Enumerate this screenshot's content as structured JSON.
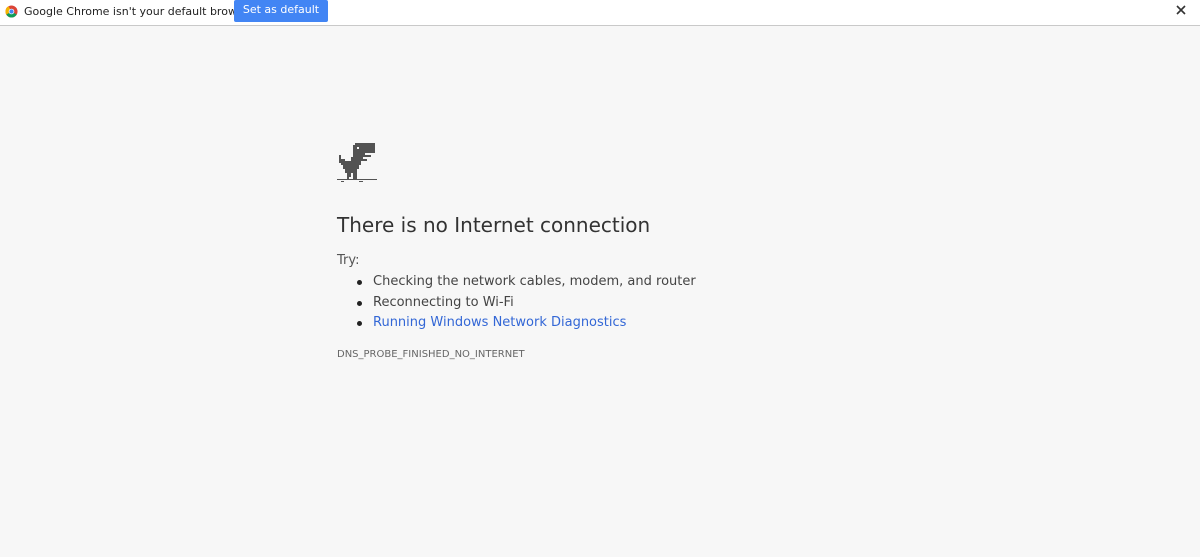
{
  "infobar": {
    "message": "Google Chrome isn't your default browser.",
    "button_label": "Set as default",
    "logo_icon": "chrome-logo-icon",
    "close_icon": "close-icon",
    "button_color": "#4285f4"
  },
  "main": {
    "dino_icon": "dino-icon",
    "title": "There is no Internet connection",
    "try_label": "Try:",
    "suggestions": [
      "Checking the network cables, modem, and router",
      "Reconnecting to Wi-Fi",
      "Running Windows Network Diagnostics"
    ],
    "error_code": "DNS_PROBE_FINISHED_NO_INTERNET",
    "link_color": "#3367d6"
  }
}
